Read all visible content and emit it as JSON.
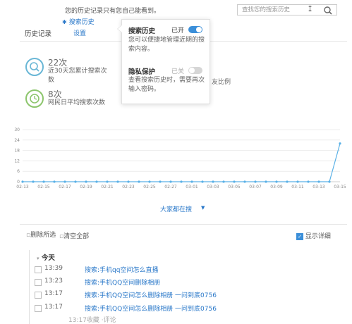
{
  "header": {
    "privacy_note": "您的历史记录只有您自己能看到。",
    "nav_search_history": "搜索历史",
    "nav_settings": "设置",
    "page_title": "历史记录",
    "search_placeholder": "查找您的搜索历史"
  },
  "stats": {
    "stat1_value": "22次",
    "stat1_desc": "近30天您累计搜索次数",
    "stat2_value": "8次",
    "stat2_desc": "网民日平均搜索次数",
    "friend_ratio_fragment": "友比例"
  },
  "popover": {
    "history_title": "搜索历史",
    "history_state": "已开",
    "history_desc": "您可以便捷地管理近期的搜索内容。",
    "privacy_title": "隐私保护",
    "privacy_state": "已关",
    "privacy_desc": "查看搜索历史时，需要再次输入密码。"
  },
  "chart_data": {
    "type": "line",
    "title": "",
    "xlabel": "",
    "ylabel": "",
    "ylim": [
      0,
      30
    ],
    "yticks": [
      "0",
      "6",
      "12",
      "18",
      "24",
      "30"
    ],
    "x": [
      "02-13",
      "02-14",
      "02-15",
      "02-16",
      "02-17",
      "02-18",
      "02-19",
      "02-20",
      "02-21",
      "02-22",
      "02-23",
      "02-24",
      "02-25",
      "02-26",
      "02-27",
      "02-28",
      "03-01",
      "03-02",
      "03-03",
      "03-04",
      "03-05",
      "03-06",
      "03-07",
      "03-08",
      "03-09",
      "03-10",
      "03-11",
      "03-12",
      "03-13",
      "03-14",
      "03-15"
    ],
    "xticks": [
      "02-13",
      "02-15",
      "02-17",
      "02-19",
      "02-21",
      "02-23",
      "02-25",
      "02-27",
      "03-01",
      "03-03",
      "03-05",
      "03-07",
      "03-09",
      "03-11",
      "03-13",
      "03-15"
    ],
    "values": [
      0,
      0,
      0,
      0,
      0,
      0,
      0,
      0,
      0,
      0,
      0,
      0,
      0,
      0,
      0,
      0,
      0,
      0,
      0,
      0,
      0,
      0,
      0,
      0,
      0,
      0,
      0,
      0,
      0,
      0,
      22
    ],
    "line_color": "#5ab1e6",
    "grid": true
  },
  "see_all": "大家都在搜",
  "actions": {
    "delete_selected": "删除所选",
    "clear_all": "清空全部",
    "show_detail": "显示详细"
  },
  "today_label": "今天",
  "history_rows": [
    {
      "time": "13:39",
      "keyword": "搜索:手机qq空间怎么直播"
    },
    {
      "time": "13:23",
      "keyword": "搜索:手机QQ空间删除相册"
    },
    {
      "time": "13:17",
      "keyword": "搜索:手机QQ空间怎么删除相册 一问到底0756"
    },
    {
      "time": "13:17",
      "keyword": "搜索:手机QQ空间怎么删除相册 一问到底0756"
    }
  ],
  "row_meta": "13:17收藏 ·评论",
  "colors": {
    "accent": "#2a78c9",
    "toggle_on": "#3b8fd9",
    "toggle_off": "#d6d6d6",
    "stat1_ring": "#6ab7d6",
    "stat2_ring": "#8cc56c"
  },
  "icons": {
    "search_button": "search-icon",
    "stat1": "search-icon",
    "stat2": "clock-icon"
  }
}
